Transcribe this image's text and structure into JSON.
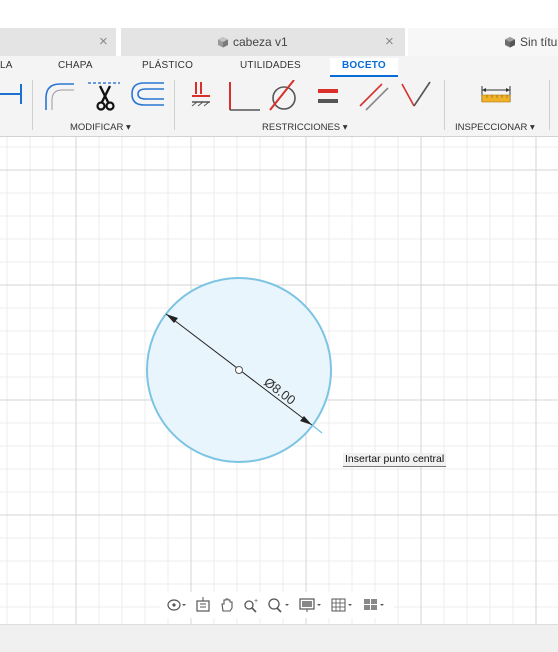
{
  "tabs": [
    {
      "title": "",
      "close": "×"
    },
    {
      "title": "cabeza v1",
      "close": "×"
    },
    {
      "title": "Sin títu",
      "close": ""
    }
  ],
  "workspace_tabs": [
    "LA",
    "CHAPA",
    "PLÁSTICO",
    "UTILIDADES",
    "BOCETO"
  ],
  "active_workspace": "BOCETO",
  "groups": {
    "modify": "MODIFICAR ▾",
    "constraints": "RESTRICCIONES ▾",
    "inspect": "INSPECCIONAR ▾"
  },
  "sketch": {
    "dimension_label": "Ø8.00",
    "tooltip": "Insertar punto central"
  },
  "navigation_tools": [
    "orbit-icon",
    "look-at-icon",
    "pan-icon",
    "zoom-icon",
    "fit-icon",
    "display-settings-icon",
    "grid-settings-icon",
    "viewports-icon"
  ],
  "colors": {
    "accent": "#0a6cd6",
    "circle_stroke": "#7cc4e4",
    "circle_fill": "#e9f5fc",
    "grid_major": "#d4d4d4",
    "grid_minor": "#ececec",
    "constraint_red": "#d9302c"
  }
}
